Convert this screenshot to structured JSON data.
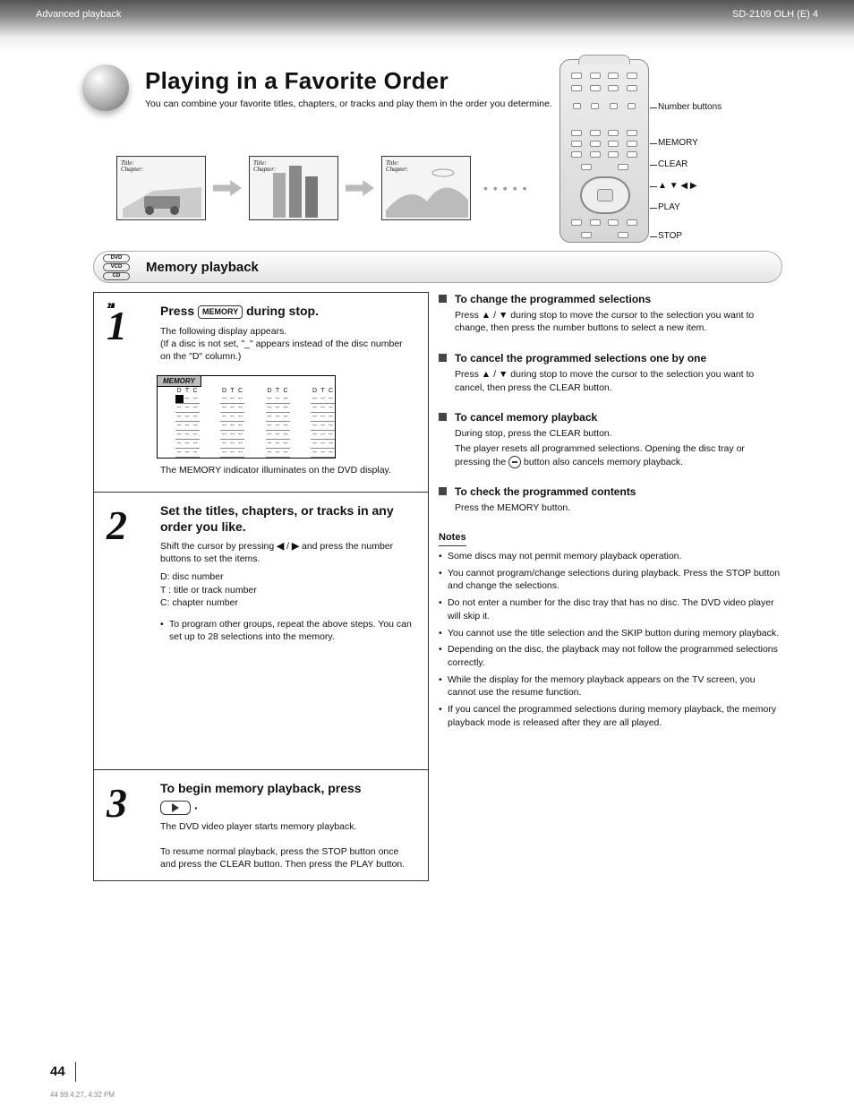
{
  "header": {
    "left": "Advanced playback",
    "right": "SD-2109 OLH (E)  4"
  },
  "title": {
    "main": "Playing in a Favorite Order",
    "sub": "You can combine your favorite titles, chapters, or tracks and play them in the order you determine."
  },
  "disc_labels": [
    "DVD",
    "VCD",
    "CD"
  ],
  "feature_title": "Memory playback",
  "thumb_label": {
    "l1": "Title:",
    "l2": "Chapter:"
  },
  "remote_labels": {
    "numbers": "Number buttons",
    "memory": "MEMORY",
    "clear": "CLEAR",
    "dirs": [
      "▲",
      "▼",
      "◀",
      "▶"
    ],
    "play": "PLAY",
    "stop": "STOP"
  },
  "osd": {
    "title": "MEMORY",
    "cols": [
      "D",
      "T",
      "C"
    ],
    "rows_per_col": 7,
    "cols_count": 4
  },
  "step1": {
    "num": "1",
    "head_a": "Press  ",
    "btn": "MEMORY",
    "head_b": "  during stop.",
    "body1": "The following display appears.\n(If a disc is not set, \"_\" appears instead of the disc number on the \"D\" column.)",
    "body2": "The MEMORY indicator illuminates on the DVD display."
  },
  "step2": {
    "num": "2",
    "head": "Set the titles, chapters, or tracks in any order you like.",
    "line1_a": "Shift the cursor by pressing ",
    "left": "◀",
    "slash": " / ",
    "right": "▶",
    "line1_b": " and press the number buttons to set the items.",
    "sub1": "D: disc number\nT : title or track number\nC: chapter number",
    "note_bullet": "To program other groups, repeat the above steps. You can set up to 28 selections into the memory."
  },
  "step3": {
    "num": "3",
    "head": "To begin memory playback, press",
    "body": "The DVD video player starts memory playback.\n\nTo resume normal playback, press the STOP button once and press the CLEAR button. Then press the PLAY button."
  },
  "rc": {
    "b1": {
      "h": "To change the programmed selections",
      "d_a": "Press ",
      "up": "▲",
      "dn": "▼",
      "d_b": " during stop to move the cursor to the selection you want to change, then press the number buttons to select a new item."
    },
    "b2": {
      "h": "To cancel the programmed selections one by one",
      "d_a": "Press ",
      "up": "▲",
      "dn": "▼",
      "d_b": " during stop to move the cursor to the selection you want to cancel, then press the CLEAR button."
    },
    "b3": {
      "h": "To cancel memory playback",
      "d1": "During stop, press the CLEAR button.",
      "d2_a": "The player resets all programmed selections. Opening the disc tray or pressing the ",
      "d2_b": " button also cancels memory playback."
    },
    "b4": {
      "h": "To check the programmed contents",
      "d": "Press the MEMORY button."
    }
  },
  "notes": {
    "h": "Notes",
    "items": [
      "Some discs may not permit memory playback operation.",
      "You cannot program/change selections during playback. Press the STOP button and change the selections.",
      "Do not enter a number for the disc tray that has no disc. The DVD video player will skip it.",
      "You cannot use the title selection and the SKIP button during memory playback.",
      "Depending on the disc, the playback may not follow the programmed selections correctly.",
      "While the display for the memory playback appears on the TV screen, you cannot use the resume function.",
      "If you cancel the programmed selections during memory playback, the memory playback mode is released after they are all played."
    ]
  },
  "footer": {
    "page": "44",
    "meta": "44                                                                                                                                                                                                          99.4.27, 4:32 PM"
  }
}
